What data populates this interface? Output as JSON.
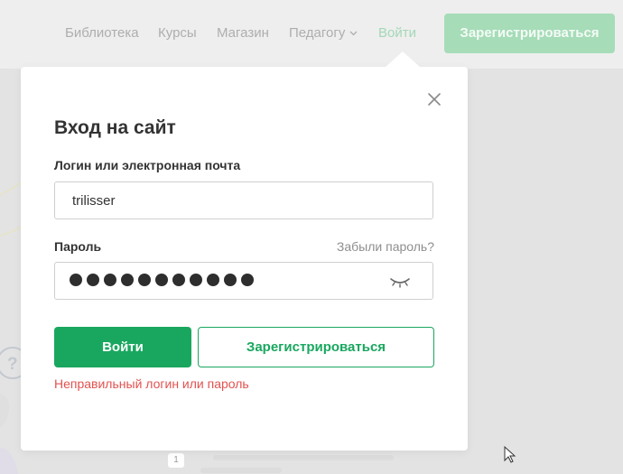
{
  "colors": {
    "brand_green": "#19a75f",
    "error_red": "#e2524f",
    "nav_inactive": "#aeaeae",
    "nav_active": "#a3d8b6"
  },
  "nav": {
    "items": [
      {
        "label": "Библиотека"
      },
      {
        "label": "Курсы"
      },
      {
        "label": "Магазин"
      },
      {
        "label": "Педагогу"
      },
      {
        "label": "Войти"
      }
    ],
    "teacher_icon": "chevron-down-icon",
    "register_label": "Зарегистрироваться"
  },
  "background": {
    "list_number": "1"
  },
  "login": {
    "title": "Вход на сайт",
    "close_icon": "close-icon",
    "login_label": "Логин или электронная почта",
    "login_value": "trilisser",
    "password_label": "Пароль",
    "forgot_link": "Забыли пароль?",
    "password_length": 11,
    "eye_icon": "eye-closed-icon",
    "submit_label": "Войти",
    "register_label": "Зарегистрироваться",
    "error_message": "Неправильный логин или пароль"
  }
}
